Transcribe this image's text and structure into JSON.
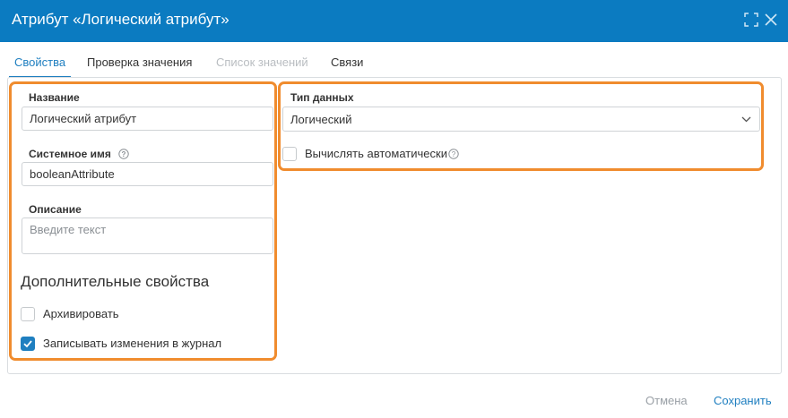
{
  "window": {
    "title": "Атрибут «Логический атрибут»"
  },
  "tabs": [
    {
      "label": "Свойства",
      "state": "active"
    },
    {
      "label": "Проверка значения",
      "state": "normal"
    },
    {
      "label": "Список значений",
      "state": "disabled"
    },
    {
      "label": "Связи",
      "state": "normal"
    }
  ],
  "form": {
    "name": {
      "label": "Название",
      "value": "Логический атрибут"
    },
    "system_name": {
      "label": "Системное имя",
      "value": "booleanAttribute"
    },
    "description": {
      "label": "Описание",
      "placeholder": "Введите текст"
    },
    "additional_title": "Дополнительные свойства",
    "archive": {
      "label": "Архивировать",
      "checked": false
    },
    "log_changes": {
      "label": "Записывать изменения в журнал",
      "checked": true
    },
    "data_type": {
      "label": "Тип данных",
      "value": "Логический"
    },
    "auto_calc": {
      "label": "Вычислять автоматически",
      "checked": false
    }
  },
  "footer": {
    "cancel_label": "Отмена",
    "save_label": "Сохранить"
  },
  "colors": {
    "titlebar": "#0b7bc1",
    "accent": "#1f7fc0",
    "highlight": "#f08c2e"
  },
  "icons": [
    "expand-icon",
    "close-icon",
    "help-icon",
    "chevron-down-icon",
    "checkmark-icon"
  ]
}
